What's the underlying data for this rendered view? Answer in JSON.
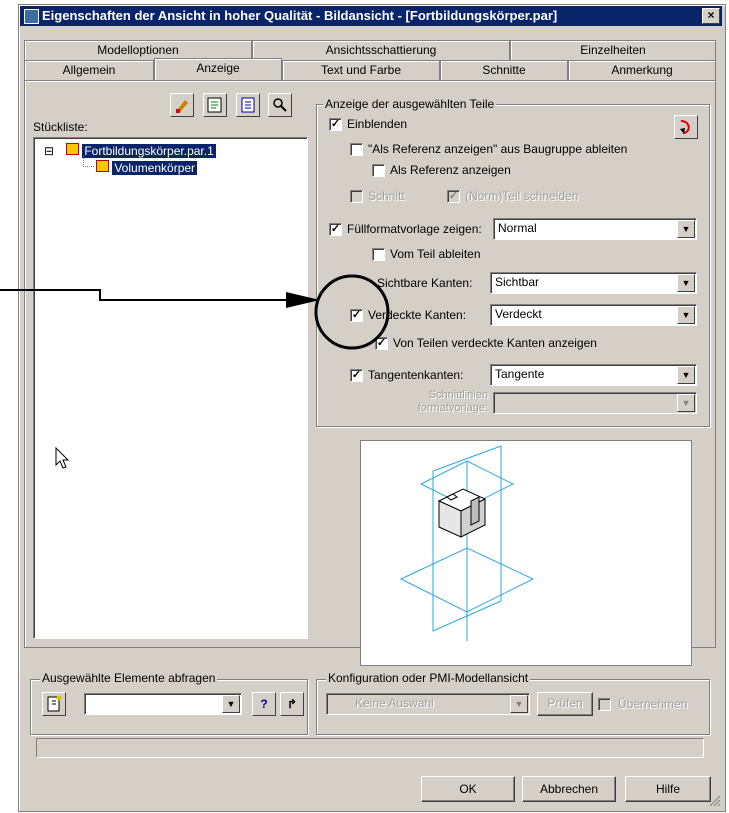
{
  "window": {
    "title": "Eigenschaften der Ansicht in hoher Qualität - Bildansicht - [Fortbildungskörper.par]",
    "close_glyph": "×"
  },
  "tabs_row1": [
    "Modelloptionen",
    "Ansichtsschattierung",
    "Einzelheiten"
  ],
  "tabs_row2": [
    "Allgemein",
    "Anzeige",
    "Text und Farbe",
    "Schnitte",
    "Anmerkung"
  ],
  "active_tab": "Anzeige",
  "left": {
    "toolbar_icons": [
      "brush-icon",
      "properties-icon",
      "list-icon",
      "find-icon"
    ],
    "list_label": "Stückliste:",
    "tree": [
      {
        "toggle": "⊟",
        "label": "Fortbildungskörper.par.1"
      },
      {
        "toggle": "",
        "label": "Volumenkörper"
      }
    ]
  },
  "display_group": {
    "label": "Anzeige der ausgewählten Teile",
    "show": {
      "label": "Einblenden",
      "checked": true,
      "mark": "✓"
    },
    "derive_ref": {
      "label": "\"Als Referenz anzeigen\" aus Baugruppe ableiten",
      "checked": false
    },
    "as_ref": {
      "label": "Als Referenz anzeigen",
      "checked": false
    },
    "section": {
      "label": "Schnitt",
      "checked": false
    },
    "norm_cut": {
      "label": "(Norm)Teil schneiden",
      "checked": true,
      "mark": "✓"
    },
    "fill_style": {
      "label": "Füllformatvorlage zeigen:",
      "checked": true,
      "mark": "✓",
      "value": "Normal"
    },
    "from_part": {
      "label": "Vom Teil ableiten",
      "checked": false
    },
    "visible_edges": {
      "label": "Sichtbare Kanten:",
      "value": "Sichtbar"
    },
    "hidden_edges": {
      "label": "Verdeckte Kanten:",
      "checked": true,
      "mark": "✓",
      "value": "Verdeckt"
    },
    "hidden_by_parts": {
      "label": "Von Teilen verdeckte Kanten anzeigen",
      "checked": true,
      "mark": "✓"
    },
    "tangent_edges": {
      "label": "Tangentenkanten:",
      "checked": true,
      "mark": "✓",
      "value": "Tangente"
    },
    "section_lines": {
      "label_line1": "Schnittlinien",
      "label_line2": "formatvorlage:",
      "value": ""
    },
    "combo_arrow": "▼"
  },
  "query_group": {
    "label": "Ausgewählte Elemente abfragen",
    "value": "",
    "help_glyph": "?",
    "go_glyph": "↱"
  },
  "config_group": {
    "label": "Konfiguration oder PMI-Modellansicht",
    "value": "Keine Auswahl",
    "check_button": "Prüfen",
    "apply_label": "Übernehmen"
  },
  "footer": {
    "ok": "OK",
    "cancel": "Abbrechen",
    "help": "Hilfe"
  },
  "colors": {
    "title_bar": "#0a246a",
    "dialog": "#d4d0c8",
    "preview_lines": "#29a8e0",
    "callout": "#000000"
  }
}
